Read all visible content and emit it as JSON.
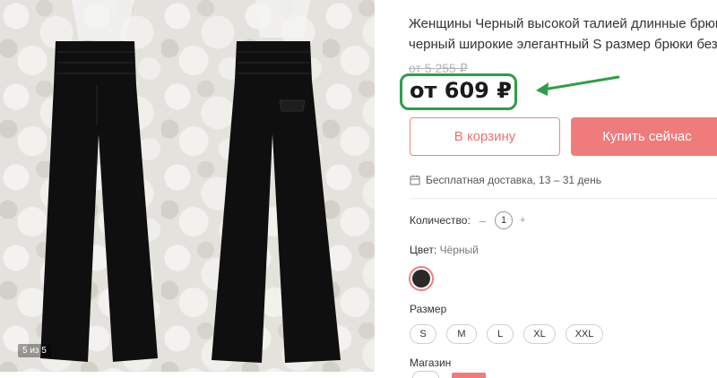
{
  "gallery": {
    "counter": "5 из 5"
  },
  "product": {
    "title_line1": "Женщины Черный высокой талией длинные брюки",
    "title_line2": "черный широкие элегантный S размер брюки без",
    "old_price": "от 5 255 ₽",
    "price": "от 609 ₽"
  },
  "actions": {
    "cart_label": "В корзину",
    "buy_label": "Купить сейчас"
  },
  "delivery": {
    "icon": "calendar-icon",
    "text": "Бесплатная доставка, 13 – 31 день"
  },
  "quantity": {
    "label": "Количество:",
    "minus": "–",
    "value": "1",
    "plus": "+"
  },
  "color": {
    "label": "Цвет:",
    "value": "Чёрный",
    "swatch_hex": "#2a2a2a"
  },
  "size": {
    "label": "Размер",
    "options": [
      "S",
      "M",
      "L",
      "XL",
      "XXL"
    ]
  },
  "store": {
    "label": "Магазин"
  },
  "colors": {
    "accent": "#f07b7b",
    "highlight": "#2e9e48"
  }
}
